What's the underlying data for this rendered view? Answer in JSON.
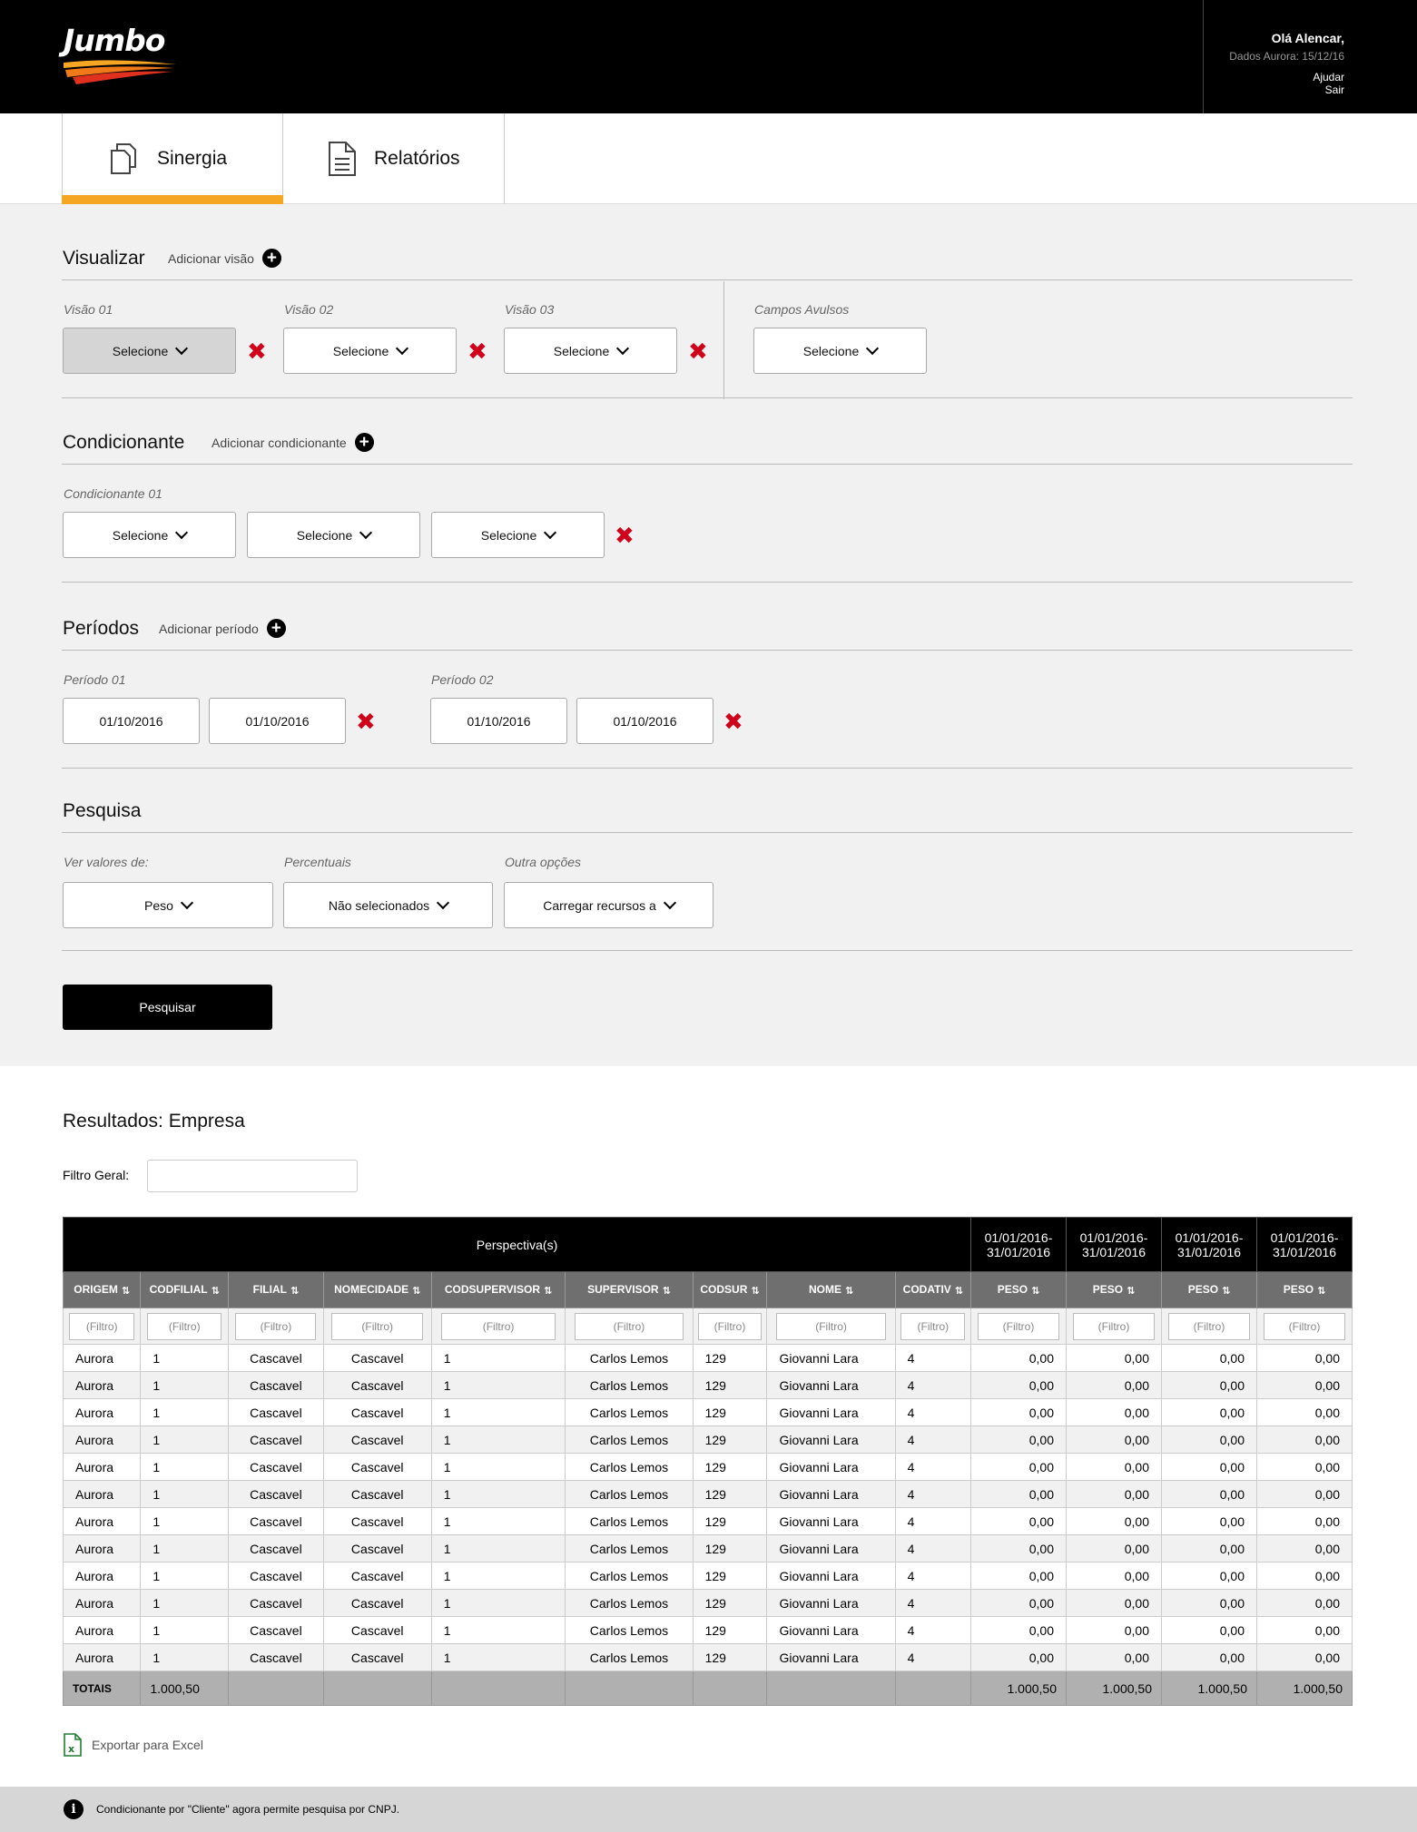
{
  "header": {
    "logo": "Jumbo",
    "greeting": "Olá Alencar,",
    "data_date": "Dados Aurora: 15/12/16",
    "help": "Ajudar",
    "logout": "Sair"
  },
  "tabs": [
    {
      "label": "Sinergia",
      "icon": "copy-documents-icon",
      "active": true
    },
    {
      "label": "Relatórios",
      "icon": "document-lines-icon",
      "active": false
    }
  ],
  "visualizar": {
    "title": "Visualizar",
    "add_label": "Adicionar visão",
    "fields": [
      {
        "label": "Visão 01",
        "value": "Selecione"
      },
      {
        "label": "Visão 02",
        "value": "Selecione"
      },
      {
        "label": "Visão 03",
        "value": "Selecione"
      }
    ],
    "campos_avulsos": {
      "label": "Campos Avulsos",
      "value": "Selecione"
    }
  },
  "condicionante": {
    "title": "Condicionante",
    "add_label": "Adicionar condicionante",
    "group_label": "Condicionante 01",
    "values": [
      "Selecione",
      "Selecione",
      "Selecione"
    ]
  },
  "periodos": {
    "title": "Períodos",
    "add_label": "Adicionar período",
    "groups": [
      {
        "label": "Período 01",
        "start": "01/10/2016",
        "end": "01/10/2016"
      },
      {
        "label": "Período 02",
        "start": "01/10/2016",
        "end": "01/10/2016"
      }
    ]
  },
  "pesquisa": {
    "title": "Pesquisa",
    "fields": [
      {
        "label": "Ver valores de:",
        "value": "Peso"
      },
      {
        "label": "Percentuais",
        "value": "Não selecionados"
      },
      {
        "label": "Outra opções",
        "value": "Carregar recursos a"
      }
    ],
    "button": "Pesquisar"
  },
  "results": {
    "title": "Resultados: Empresa",
    "filter_label": "Filtro Geral:",
    "perspective_header": "Perspectiva(s)",
    "period_headers": [
      "01/01/2016-31/01/2016",
      "01/01/2016-31/01/2016",
      "01/01/2016-31/01/2016",
      "01/01/2016-31/01/2016"
    ],
    "columns": [
      "ORIGEM",
      "CODFILIAL",
      "FILIAL",
      "NOMECIDADE",
      "CODSUPERVISOR",
      "SUPERVISOR",
      "CODSUR",
      "NOME",
      "CODATIV",
      "PESO",
      "PESO",
      "PESO",
      "PESO"
    ],
    "filter_placeholder": "(Filtro)",
    "rows": [
      [
        "Aurora",
        "1",
        "Cascavel",
        "Cascavel",
        "1",
        "Carlos Lemos",
        "129",
        "Giovanni Lara",
        "4",
        "0,00",
        "0,00",
        "0,00",
        "0,00"
      ],
      [
        "Aurora",
        "1",
        "Cascavel",
        "Cascavel",
        "1",
        "Carlos Lemos",
        "129",
        "Giovanni Lara",
        "4",
        "0,00",
        "0,00",
        "0,00",
        "0,00"
      ],
      [
        "Aurora",
        "1",
        "Cascavel",
        "Cascavel",
        "1",
        "Carlos Lemos",
        "129",
        "Giovanni Lara",
        "4",
        "0,00",
        "0,00",
        "0,00",
        "0,00"
      ],
      [
        "Aurora",
        "1",
        "Cascavel",
        "Cascavel",
        "1",
        "Carlos Lemos",
        "129",
        "Giovanni Lara",
        "4",
        "0,00",
        "0,00",
        "0,00",
        "0,00"
      ],
      [
        "Aurora",
        "1",
        "Cascavel",
        "Cascavel",
        "1",
        "Carlos Lemos",
        "129",
        "Giovanni Lara",
        "4",
        "0,00",
        "0,00",
        "0,00",
        "0,00"
      ],
      [
        "Aurora",
        "1",
        "Cascavel",
        "Cascavel",
        "1",
        "Carlos Lemos",
        "129",
        "Giovanni Lara",
        "4",
        "0,00",
        "0,00",
        "0,00",
        "0,00"
      ],
      [
        "Aurora",
        "1",
        "Cascavel",
        "Cascavel",
        "1",
        "Carlos Lemos",
        "129",
        "Giovanni Lara",
        "4",
        "0,00",
        "0,00",
        "0,00",
        "0,00"
      ],
      [
        "Aurora",
        "1",
        "Cascavel",
        "Cascavel",
        "1",
        "Carlos Lemos",
        "129",
        "Giovanni Lara",
        "4",
        "0,00",
        "0,00",
        "0,00",
        "0,00"
      ],
      [
        "Aurora",
        "1",
        "Cascavel",
        "Cascavel",
        "1",
        "Carlos Lemos",
        "129",
        "Giovanni Lara",
        "4",
        "0,00",
        "0,00",
        "0,00",
        "0,00"
      ],
      [
        "Aurora",
        "1",
        "Cascavel",
        "Cascavel",
        "1",
        "Carlos Lemos",
        "129",
        "Giovanni Lara",
        "4",
        "0,00",
        "0,00",
        "0,00",
        "0,00"
      ],
      [
        "Aurora",
        "1",
        "Cascavel",
        "Cascavel",
        "1",
        "Carlos Lemos",
        "129",
        "Giovanni Lara",
        "4",
        "0,00",
        "0,00",
        "0,00",
        "0,00"
      ],
      [
        "Aurora",
        "1",
        "Cascavel",
        "Cascavel",
        "1",
        "Carlos Lemos",
        "129",
        "Giovanni Lara",
        "4",
        "0,00",
        "0,00",
        "0,00",
        "0,00"
      ]
    ],
    "totals": {
      "label": "TOTAIS",
      "codfilial": "1.000,50",
      "peso": [
        "1.000,50",
        "1.000,50",
        "1.000,50",
        "1.000,50"
      ]
    },
    "export": "Exportar para Excel"
  },
  "footer": {
    "message": "Condicionante por \"Cliente\" agora permite pesquisa por CNPJ."
  },
  "colors": {
    "accent": "#f5a623",
    "remove": "#d0021b",
    "header_bg": "#000000"
  }
}
